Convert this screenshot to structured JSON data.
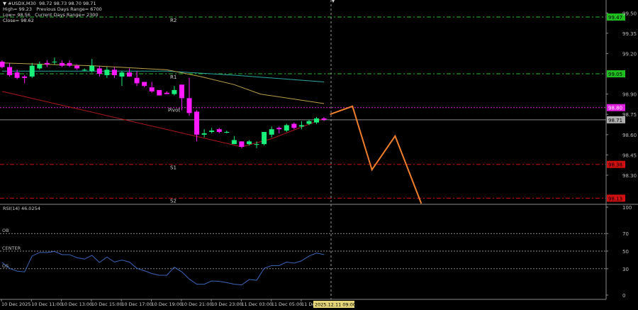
{
  "header": {
    "dropdown_icon": "triangle-down-icon",
    "symbol_line": "#USDX,M30  98.72 98.73 98.70 98.71",
    "high": "High= 99.23",
    "prev_range": "Previous Days Range= 6700",
    "low": "Low= 98.56",
    "curr_range": "Current Days Range= 2300",
    "close": "Close= 98.62"
  },
  "colors": {
    "background": "#000000",
    "bull": "#19f07a",
    "bear": "#ff1aff",
    "resistance": "#1fbf1f",
    "pivot": "#e020e0",
    "support": "#d01010",
    "ma_teal": "#2aa7a0",
    "ma_yellow": "#b8a14a",
    "trend_red": "#b01818",
    "projection": "#f07f2a",
    "rsi": "#3b64b8"
  },
  "chart_data": [
    {
      "type": "candlestick",
      "title": "#USDX,M30",
      "ylim": [
        98.09,
        99.596
      ],
      "y_ticks": [
        "99.50",
        "99.35",
        "99.20",
        "98.90",
        "98.75",
        "98.60",
        "98.45",
        "98.30"
      ],
      "x_tick_labels": [
        "10 Dec 2025",
        "10 Dec 11:00",
        "10 Dec 13:00",
        "10 Dec 15:00",
        "10 Dec 17:00",
        "10 Dec 19:00",
        "10 Dec 21:00",
        "10 Dec 23:00",
        "11 Dec 03:00",
        "11 Dec 05:00",
        "11 De"
      ],
      "crosshair_time_label": "2025.12.11 09:00",
      "candles": [
        [
          99.14,
          99.15,
          99.09,
          99.1
        ],
        [
          99.1,
          99.13,
          99.03,
          99.04
        ],
        [
          99.06,
          99.08,
          99.01,
          99.02
        ],
        [
          99.03,
          99.04,
          98.98,
          99.02
        ],
        [
          99.03,
          99.13,
          99.02,
          99.11
        ],
        [
          99.09,
          99.14,
          99.08,
          99.12
        ],
        [
          99.13,
          99.15,
          99.1,
          99.12
        ],
        [
          99.14,
          99.17,
          99.12,
          99.14
        ],
        [
          99.13,
          99.15,
          99.1,
          99.11
        ],
        [
          99.13,
          99.15,
          99.1,
          99.11
        ],
        [
          99.11,
          99.12,
          99.08,
          99.09
        ],
        [
          99.08,
          99.09,
          99.07,
          99.08
        ],
        [
          99.07,
          99.16,
          99.06,
          99.11
        ],
        [
          99.09,
          99.11,
          99.03,
          99.05
        ],
        [
          99.04,
          99.1,
          99.02,
          99.08
        ],
        [
          99.08,
          99.1,
          99.02,
          99.04
        ],
        [
          99.03,
          99.07,
          98.96,
          99.06
        ],
        [
          99.06,
          99.09,
          99.03,
          99.03
        ],
        [
          99.02,
          99.07,
          98.96,
          98.98
        ],
        [
          98.99,
          98.99,
          98.95,
          98.96
        ],
        [
          98.95,
          98.99,
          98.91,
          98.92
        ],
        [
          98.93,
          98.93,
          98.89,
          98.89
        ],
        [
          98.91,
          98.92,
          98.9,
          98.9
        ],
        [
          98.9,
          98.96,
          98.89,
          98.93
        ],
        [
          98.97,
          98.97,
          98.78,
          98.87
        ],
        [
          98.87,
          99.02,
          98.74,
          98.76
        ],
        [
          98.77,
          98.78,
          98.55,
          98.6
        ],
        [
          98.6,
          98.64,
          98.58,
          98.61
        ],
        [
          98.62,
          98.65,
          98.61,
          98.63
        ],
        [
          98.64,
          98.65,
          98.61,
          98.62
        ],
        [
          98.62,
          98.63,
          98.61,
          98.62
        ],
        [
          98.53,
          98.59,
          98.53,
          98.56
        ],
        [
          98.55,
          98.55,
          98.5,
          98.51
        ],
        [
          98.53,
          98.56,
          98.52,
          98.55
        ],
        [
          98.53,
          98.55,
          98.5,
          98.53
        ],
        [
          98.53,
          98.62,
          98.52,
          98.62
        ],
        [
          98.6,
          98.66,
          98.58,
          98.64
        ],
        [
          98.65,
          98.66,
          98.61,
          98.64
        ],
        [
          98.63,
          98.68,
          98.62,
          98.67
        ],
        [
          98.68,
          98.69,
          98.64,
          98.65
        ],
        [
          98.66,
          98.7,
          98.64,
          98.67
        ],
        [
          98.68,
          98.71,
          98.67,
          98.7
        ],
        [
          98.69,
          98.73,
          98.68,
          98.72
        ],
        [
          98.72,
          98.73,
          98.7,
          98.71
        ]
      ],
      "moving_averages": [
        {
          "color_key": "ma_teal",
          "points": [
            [
              0,
              99.07
            ],
            [
              22,
              99.07
            ],
            [
              31,
              99.04
            ],
            [
              43,
              98.99
            ]
          ]
        },
        {
          "color_key": "ma_yellow",
          "points": [
            [
              0,
              99.13
            ],
            [
              12,
              99.11
            ],
            [
              22,
              99.08
            ],
            [
              26.5,
              99.03
            ],
            [
              31,
              98.97
            ],
            [
              34.5,
              98.9
            ],
            [
              43,
              98.83
            ]
          ]
        },
        {
          "color_key": "trend_red",
          "points": [
            [
              0,
              98.92
            ],
            [
              32,
              98.51
            ],
            [
              36,
              98.57
            ],
            [
              43,
              98.72
            ]
          ]
        }
      ],
      "projection": [
        [
          43.8,
          98.75
        ],
        [
          46.8,
          98.81
        ],
        [
          49.4,
          98.34
        ],
        [
          52.5,
          98.59
        ],
        [
          56,
          98.09
        ]
      ],
      "pivot_levels": [
        {
          "label": "R2",
          "price": "99.47",
          "color_key": "resistance"
        },
        {
          "label": "R1",
          "price": "99.05",
          "color_key": "resistance"
        },
        {
          "label": "Pivot",
          "price": "98.80",
          "color_key": "pivot"
        },
        {
          "label": "S1",
          "price": "98.38",
          "color_key": "support"
        },
        {
          "label": "S2",
          "price": "98.13",
          "color_key": "support"
        }
      ],
      "current_price": "98.71"
    },
    {
      "type": "line",
      "title": "RSI(14) 46.0254",
      "ylim": [
        0,
        100
      ],
      "y_ticks": [
        "100",
        "70",
        "50",
        "30",
        "0"
      ],
      "levels": [
        {
          "label": "OB",
          "value": 70
        },
        {
          "label": "CENTER",
          "value": 50
        },
        {
          "label": "OS",
          "value": 30
        }
      ],
      "values": [
        37.1,
        30.4,
        27.2,
        26.4,
        44.4,
        48.4,
        48.4,
        49.7,
        46,
        46,
        42.5,
        40.9,
        45.2,
        37.1,
        43.3,
        37.6,
        39.8,
        37.6,
        30.4,
        27.7,
        24.5,
        22.6,
        22.6,
        31.7,
        26.4,
        18.3,
        12.4,
        12.4,
        16.1,
        15.6,
        14.2,
        12.4,
        11.6,
        17.7,
        16.9,
        30.4,
        33.6,
        33.6,
        37.6,
        36.3,
        39,
        44.4,
        47.8,
        46.03
      ]
    }
  ]
}
